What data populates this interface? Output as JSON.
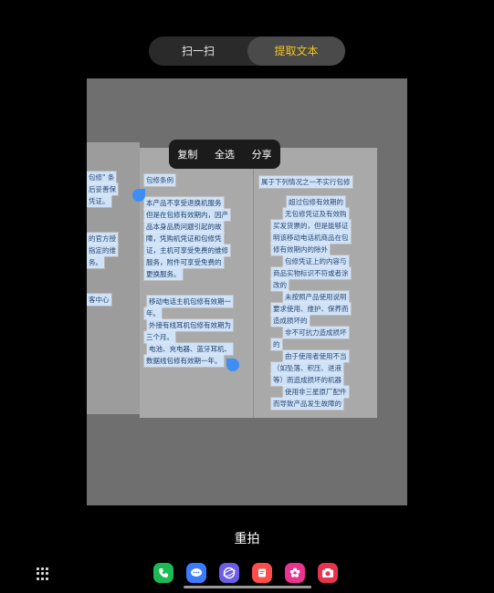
{
  "mode_switch": {
    "scan_label": "扫一扫",
    "extract_label": "提取文本"
  },
  "context_menu": {
    "copy": "复制",
    "select_all": "全选",
    "share": "分享"
  },
  "document": {
    "left_fragments": [
      "包修\" 条",
      "后妥善保",
      "凭证。",
      "的官方授",
      "指定的维",
      "务。",
      "客中心"
    ],
    "middle_title": "包修条例",
    "middle_para1": [
      "本产品不享受退换机服务",
      "但是在包修有效期内，因产",
      "品本身品质问题引起的故",
      "障，凭购机凭证和包修凭",
      "证，主机可享受免费的维修",
      "服务，附件可享受免费的",
      "更换服务。"
    ],
    "middle_para2": [
      "移动电话主机包修有效期一",
      "年。",
      "外接有线耳机包修有效期为",
      "三个月。",
      "电池、充电器、蓝牙耳机、",
      "数据线包修有效期一年。"
    ],
    "right_title": "属于下列情况之一不实行包修",
    "right_lines": [
      "超过包修有效期的",
      "无包修凭证及有效购",
      "买发货票的，但是能够证",
      "明该移动电话机商品在包",
      "修有效期内的除外",
      "包修凭证上的内容与",
      "商品实物标识不符或者涂",
      "改的",
      "未按照产品使用说明",
      "要求使用、维护、保养而",
      "造成损坏的",
      "非不可抗力造成损坏",
      "的",
      "由于使用者使用不当",
      "（如坠落、积压、进液",
      "等）而造成损坏的机器",
      "使用非三星原厂配件",
      "而导致产品发生故障的"
    ]
  },
  "retake_label": "重拍",
  "dock": {
    "apps": [
      {
        "icon": "phone-icon",
        "color": "#1db954"
      },
      {
        "icon": "messages-icon",
        "color": "#3a7bff"
      },
      {
        "icon": "browser-icon",
        "color": "#6c5ce7"
      },
      {
        "icon": "notes-icon",
        "color": "#ff4d4d"
      },
      {
        "icon": "gallery-icon",
        "color": "#e8338f"
      },
      {
        "icon": "camera-icon",
        "color": "#e8334f"
      }
    ]
  }
}
